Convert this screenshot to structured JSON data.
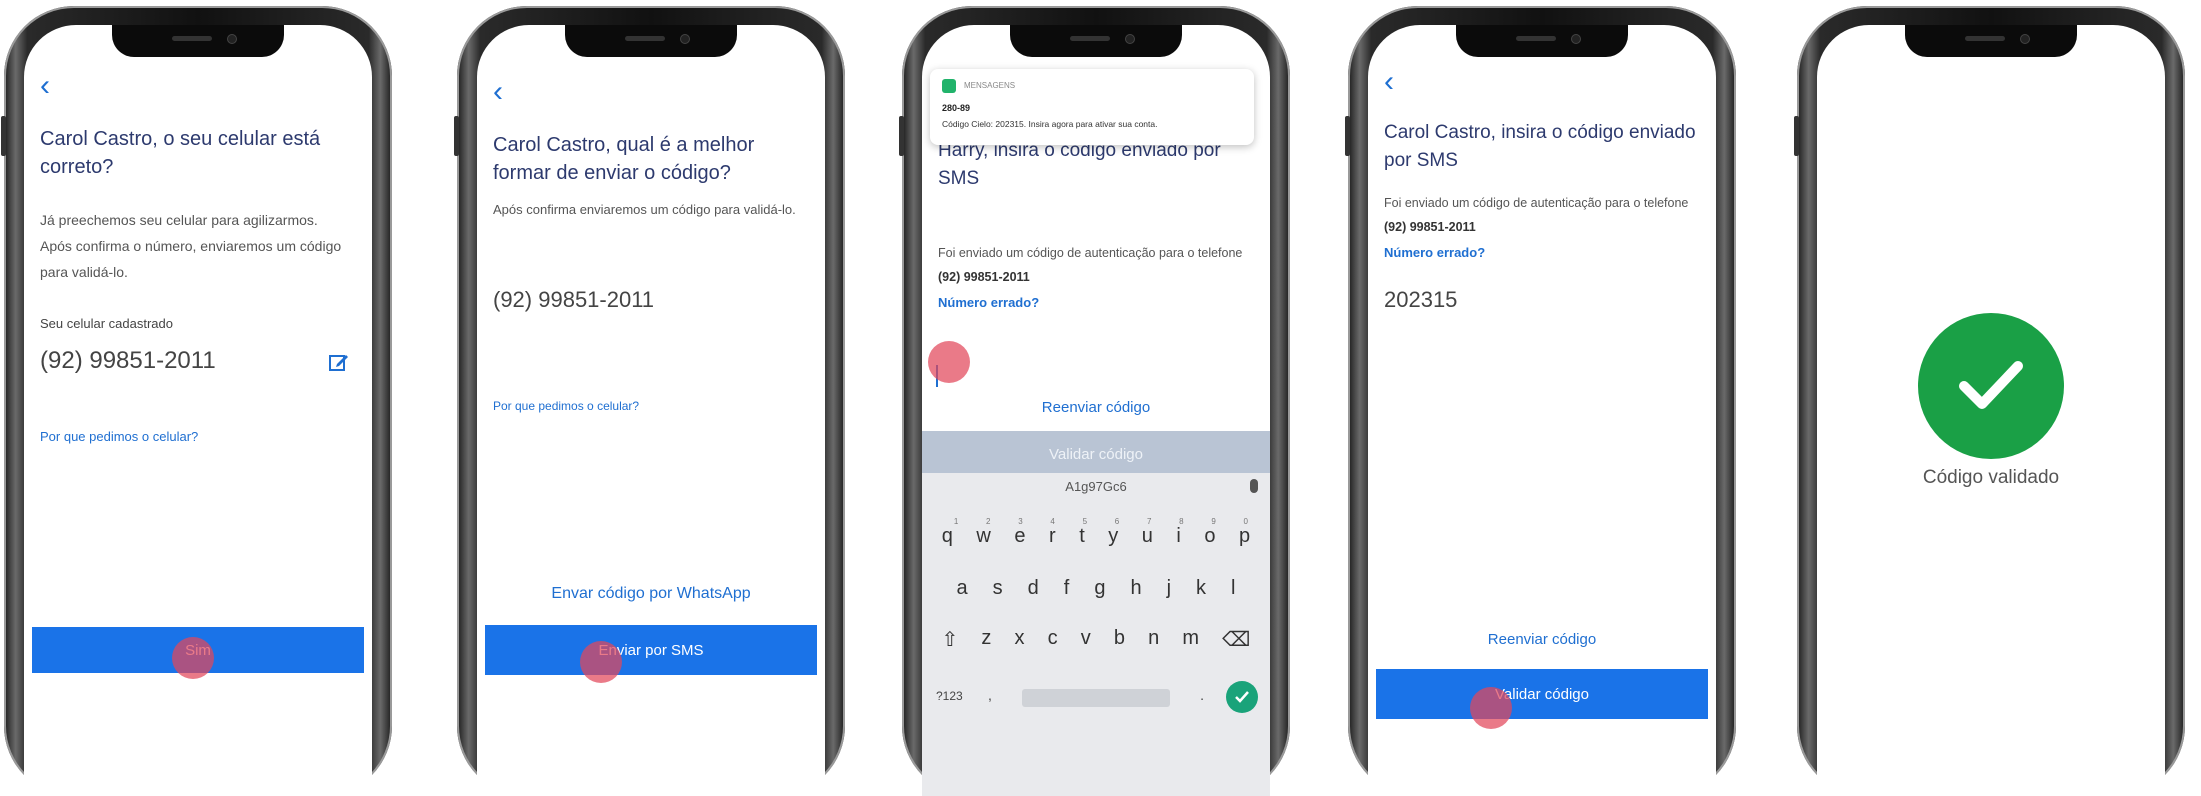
{
  "colors": {
    "accent": "#1a73e8",
    "title": "#2d3a6e",
    "success": "#1aa046",
    "tap_marker": "#e2465a"
  },
  "screens": [
    {
      "title": "Carol Castro, o seu celular está correto?",
      "description": "Já preechemos seu celular para agilizarmos. Após confirma o número, enviaremos um código para validá-lo.",
      "phone_label": "Seu celular cadastrado",
      "phone_number": "(92) 99851-2011",
      "edit_icon": "edit-icon",
      "link": "Por que pedimos o celular?",
      "button": "Sim"
    },
    {
      "title": "Carol Castro, qual é a melhor formar de enviar o código?",
      "description": "Após confirma enviaremos um código para validá-lo.",
      "phone_number": "(92) 99851-2011",
      "link": "Por que pedimos o celular?",
      "secondary_link": "Envar código por WhatsApp",
      "button": "Enviar por SMS"
    },
    {
      "notification": {
        "app": "MENSAGENS",
        "sender": "280-89",
        "message": "Código Cielo: 202315. Insira agora para ativar sua conta."
      },
      "title": "Harry, insira o código enviado por SMS",
      "description_prefix": "Foi enviado um código de autenticação para o telefone",
      "phone_number": "(92) 99851-2011",
      "wrong_number": "Número errado?",
      "resend": "Reenviar código",
      "button": "Validar código",
      "keyboard": {
        "suggestion": "A1g97Gc6",
        "row1": [
          "q",
          "w",
          "e",
          "r",
          "t",
          "y",
          "u",
          "i",
          "o",
          "p"
        ],
        "row1_hints": [
          "1",
          "2",
          "3",
          "4",
          "5",
          "6",
          "7",
          "8",
          "9",
          "0"
        ],
        "row2": [
          "a",
          "s",
          "d",
          "f",
          "g",
          "h",
          "j",
          "k",
          "l"
        ],
        "row3": [
          "z",
          "x",
          "c",
          "v",
          "b",
          "n",
          "m"
        ],
        "symbols_key": "?123",
        "comma_key": ",",
        "period_key": "."
      }
    },
    {
      "title": "Carol Castro, insira o código enviado por SMS",
      "description_prefix": "Foi enviado um código de autenticação para o telefone",
      "phone_number": "(92) 99851-2011",
      "wrong_number": "Número errado?",
      "code": "202315",
      "resend": "Reenviar código",
      "button": "Validar código"
    },
    {
      "status": "Código validado"
    }
  ]
}
